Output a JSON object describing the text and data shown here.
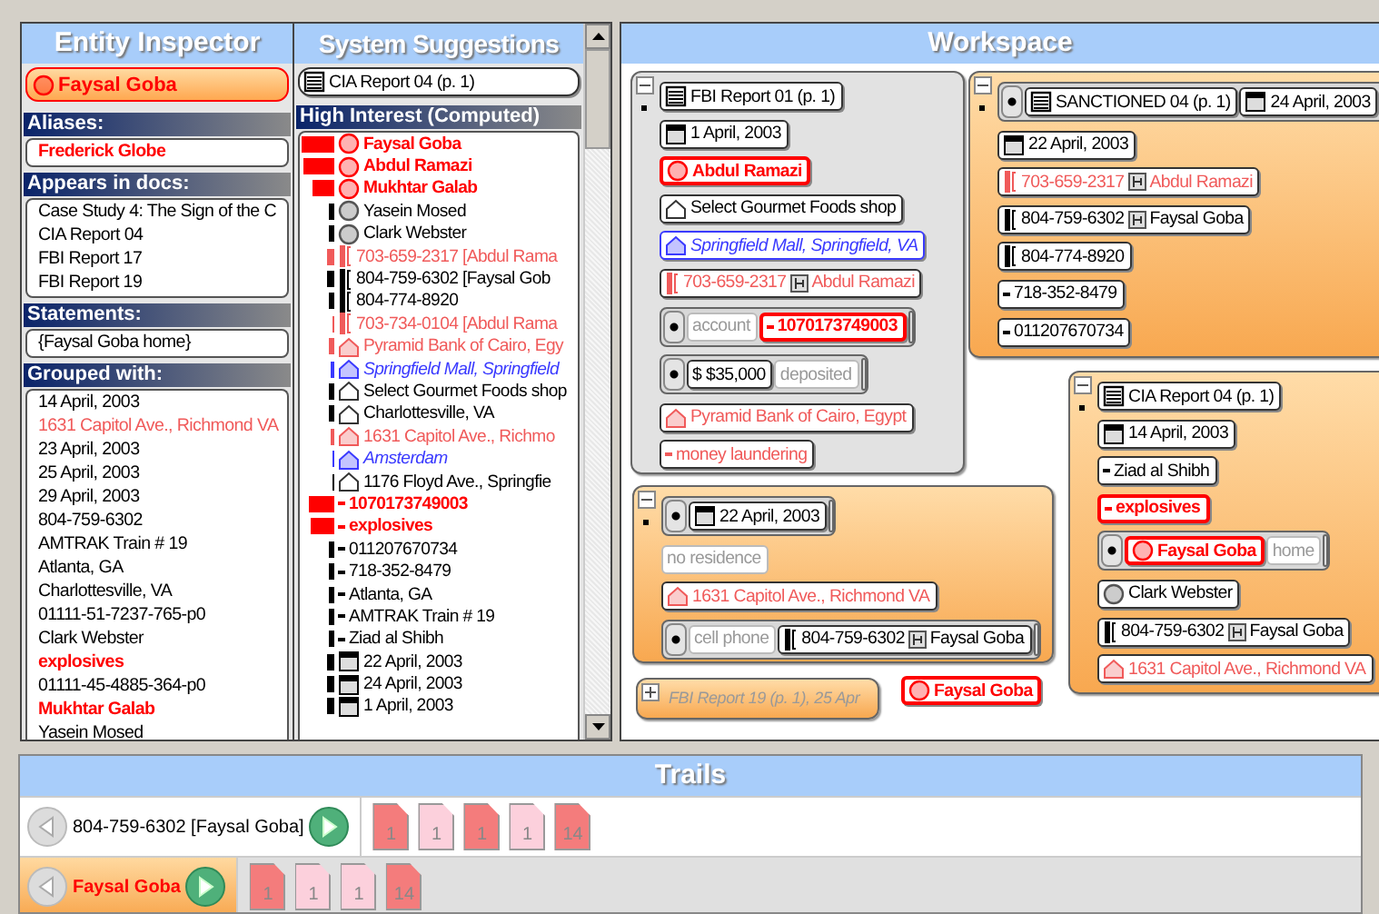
{
  "inspector": {
    "title": "Entity Inspector",
    "entity": {
      "kind": "person",
      "text": "Faysal Goba",
      "color": "#ff0000"
    },
    "sections": [
      {
        "title": "Aliases:",
        "items": [
          {
            "text": "Frederick Globe",
            "color": "#ff0000"
          }
        ]
      },
      {
        "title": "Appears in docs:",
        "items": [
          {
            "text": "Case Study 4: The Sign of the C",
            "color": "#000000"
          },
          {
            "text": "CIA Report 04",
            "color": "#000000"
          },
          {
            "text": "FBI Report 17",
            "color": "#000000"
          },
          {
            "text": "FBI Report 19",
            "color": "#000000"
          }
        ]
      },
      {
        "title": "Statements:",
        "items": [
          {
            "text": "{Faysal Goba home}",
            "color": "#000000"
          }
        ]
      },
      {
        "title": "Grouped with:",
        "items": [
          {
            "text": "14 April, 2003",
            "color": "#000000"
          },
          {
            "text": "1631 Capitol Ave., Richmond VA",
            "color": "#f05a5a"
          },
          {
            "text": "23 April, 2003",
            "color": "#000000"
          },
          {
            "text": "25 April, 2003",
            "color": "#000000"
          },
          {
            "text": "29 April, 2003",
            "color": "#000000"
          },
          {
            "text": "804-759-6302",
            "color": "#000000"
          },
          {
            "text": "AMTRAK Train # 19",
            "color": "#000000"
          },
          {
            "text": "Atlanta, GA",
            "color": "#000000"
          },
          {
            "text": "Charlottesville, VA",
            "color": "#000000"
          },
          {
            "text": "01111-51-7237-765-p0",
            "color": "#000000"
          },
          {
            "text": "Clark Webster",
            "color": "#000000"
          },
          {
            "text": "explosives",
            "color": "#ff0000"
          },
          {
            "text": "01111-45-4885-364-p0",
            "color": "#000000"
          },
          {
            "text": "Mukhtar Galab",
            "color": "#ff0000"
          },
          {
            "text": "Yasein Mosed",
            "color": "#000000"
          }
        ]
      }
    ]
  },
  "suggestions": {
    "title": "System Suggestions",
    "document": {
      "kind": "doc",
      "text": "CIA Report 04 (p. 1)",
      "color": "#000000"
    },
    "section": "High Interest (Computed)",
    "items": [
      {
        "kind": "person",
        "text": "Faysal Goba",
        "color": "#ff0000"
      },
      {
        "kind": "person",
        "text": "Abdul Ramazi",
        "color": "#ff0000"
      },
      {
        "kind": "person",
        "text": "Mukhtar Galab",
        "color": "#ff0000"
      },
      {
        "kind": "person",
        "text": "Yasein Mosed",
        "color": "#000000"
      },
      {
        "kind": "person",
        "text": "Clark Webster",
        "color": "#000000"
      },
      {
        "kind": "phone",
        "text": "703-659-2317 [Abdul Rama",
        "color": "#f05a5a"
      },
      {
        "kind": "phone",
        "text": "804-759-6302 [Faysal Gob",
        "color": "#000000"
      },
      {
        "kind": "phone",
        "text": "804-774-8920",
        "color": "#000000"
      },
      {
        "kind": "phone",
        "text": "703-734-0104 [Abdul Rama",
        "color": "#f05a5a"
      },
      {
        "kind": "place",
        "text": "Pyramid Bank of Cairo, Egy",
        "color": "#f05a5a"
      },
      {
        "kind": "place",
        "text": "Springfield Mall, Springfield",
        "color": "#3a3aff"
      },
      {
        "kind": "place",
        "text": "Select Gourmet Foods shop",
        "color": "#000000"
      },
      {
        "kind": "place",
        "text": "Charlottesville, VA",
        "color": "#000000"
      },
      {
        "kind": "place",
        "text": "1631 Capitol Ave., Richmo",
        "color": "#f05a5a"
      },
      {
        "kind": "place",
        "text": "Amsterdam",
        "color": "#3a3aff"
      },
      {
        "kind": "place",
        "text": "1176 Floyd Ave., Springfie",
        "color": "#000000"
      },
      {
        "kind": "thing",
        "text": "1070173749003",
        "color": "#ff0000"
      },
      {
        "kind": "thing",
        "text": "explosives",
        "color": "#ff0000"
      },
      {
        "kind": "thing",
        "text": "011207670734",
        "color": "#000000"
      },
      {
        "kind": "thing",
        "text": "718-352-8479",
        "color": "#000000"
      },
      {
        "kind": "thing",
        "text": "Atlanta, GA",
        "color": "#000000"
      },
      {
        "kind": "thing",
        "text": "AMTRAK Train # 19",
        "color": "#000000"
      },
      {
        "kind": "thing",
        "text": "Ziad al Shibh",
        "color": "#000000"
      },
      {
        "kind": "date",
        "text": "22 April, 2003",
        "color": "#000000"
      },
      {
        "kind": "date",
        "text": "24 April, 2003",
        "color": "#000000"
      },
      {
        "kind": "date",
        "text": "1 April, 2003",
        "color": "#000000"
      }
    ]
  },
  "workspace": {
    "title": "Workspace",
    "items": [
      {
        "kind": "card",
        "expanded": true,
        "rows": [
          {
            "kind": "doc",
            "text": "FBI Report 01 (p. 1)",
            "color": "#000000"
          },
          {
            "kind": "date",
            "text": "1 April, 2003",
            "color": "#000000"
          },
          {
            "kind": "person",
            "text": "Abdul Ramazi",
            "color": "#ff0000"
          },
          {
            "kind": "place",
            "text": "Select Gourmet Foods shop",
            "color": "#000000"
          },
          {
            "kind": "place",
            "text": "Springfield Mall, Springfield, VA",
            "color": "#3a3aff"
          },
          {
            "kind": "phone",
            "text": "703-659-2317",
            "owner": "Abdul Ramazi",
            "color": "#f05a5a"
          },
          {
            "kind": "relation",
            "items": [
              {
                "kind": "role",
                "text": "account"
              },
              {
                "kind": "thing",
                "text": "1070173749003",
                "color": "#ff0000"
              }
            ]
          },
          {
            "kind": "relation",
            "items": [
              {
                "kind": "money",
                "text": "$ $35,000",
                "color": "#000000"
              },
              {
                "kind": "role",
                "text": "deposited"
              }
            ]
          },
          {
            "kind": "place",
            "text": "Pyramid Bank of Cairo, Egypt",
            "color": "#f05a5a"
          },
          {
            "kind": "thing",
            "text": "money laundering",
            "color": "#f05a5a"
          }
        ]
      },
      {
        "kind": "card",
        "expanded": true,
        "rows": [
          {
            "kind": "relation",
            "items": [
              {
                "kind": "doc",
                "text": "SANCTIONED 04 (p. 1)",
                "color": "#000000"
              },
              {
                "kind": "date",
                "text": "24 April, 2003",
                "color": "#000000"
              }
            ]
          },
          {
            "kind": "date",
            "text": "22 April, 2003",
            "color": "#000000"
          },
          {
            "kind": "phone",
            "text": "703-659-2317",
            "owner": "Abdul Ramazi",
            "color": "#f05a5a"
          },
          {
            "kind": "phone",
            "text": "804-759-6302",
            "owner": "Faysal Goba",
            "color": "#000000"
          },
          {
            "kind": "phone",
            "text": "804-774-8920",
            "color": "#000000"
          },
          {
            "kind": "thing",
            "text": "718-352-8479",
            "color": "#000000"
          },
          {
            "kind": "thing",
            "text": "011207670734",
            "color": "#000000"
          }
        ]
      },
      {
        "kind": "card",
        "expanded": true,
        "rows": [
          {
            "kind": "relation",
            "items": [
              {
                "kind": "date",
                "text": "22 April, 2003",
                "color": "#000000"
              }
            ]
          },
          {
            "kind": "role",
            "text": "no residence"
          },
          {
            "kind": "place",
            "text": "1631 Capitol Ave., Richmond VA",
            "color": "#f05a5a"
          },
          {
            "kind": "relation",
            "items": [
              {
                "kind": "role",
                "text": "cell phone"
              },
              {
                "kind": "phone",
                "text": "804-759-6302",
                "owner": "Faysal Goba",
                "color": "#000000"
              }
            ]
          }
        ]
      },
      {
        "kind": "card",
        "expanded": true,
        "rows": [
          {
            "kind": "doc",
            "text": "CIA Report 04 (p. 1)",
            "color": "#000000"
          },
          {
            "kind": "date",
            "text": "14 April, 2003",
            "color": "#000000"
          },
          {
            "kind": "thing",
            "text": "Ziad al Shibh",
            "color": "#000000"
          },
          {
            "kind": "thing",
            "text": "explosives",
            "color": "#ff0000"
          },
          {
            "kind": "relation",
            "items": [
              {
                "kind": "person",
                "text": "Faysal Goba",
                "color": "#ff0000"
              },
              {
                "kind": "role",
                "text": "home"
              }
            ]
          },
          {
            "kind": "person",
            "text": "Clark Webster",
            "color": "#000000"
          },
          {
            "kind": "phone",
            "text": "804-759-6302",
            "owner": "Faysal Goba",
            "color": "#000000"
          },
          {
            "kind": "place",
            "text": "1631 Capitol Ave., Richmond VA",
            "color": "#f05a5a"
          }
        ]
      },
      {
        "kind": "card",
        "expanded": false,
        "title": "FBI Report 19 (p. 1), 25 Apr"
      },
      {
        "kind": "chip",
        "chip": {
          "kind": "person",
          "text": "Faysal Goba",
          "color": "#ff0000"
        }
      }
    ]
  },
  "trails": {
    "title": "Trails",
    "rows": [
      {
        "label": "804-759-6302 [Faysal Goba]",
        "color": "#000000",
        "selected": false,
        "docs": [
          {
            "number": "1",
            "color": "#f47c7c"
          },
          {
            "number": "1",
            "color": "#fcd0dc"
          },
          {
            "number": "1",
            "color": "#f47c7c"
          },
          {
            "number": "1",
            "color": "#fcd0dc"
          },
          {
            "number": "14",
            "color": "#f47c7c"
          }
        ]
      },
      {
        "label": "Faysal Goba",
        "color": "#ff0000",
        "selected": true,
        "docs": [
          {
            "number": "1",
            "color": "#f47c7c"
          },
          {
            "number": "1",
            "color": "#fcd0dc"
          },
          {
            "number": "1",
            "color": "#fcd0dc"
          },
          {
            "number": "14",
            "color": "#f47c7c"
          }
        ]
      }
    ]
  }
}
